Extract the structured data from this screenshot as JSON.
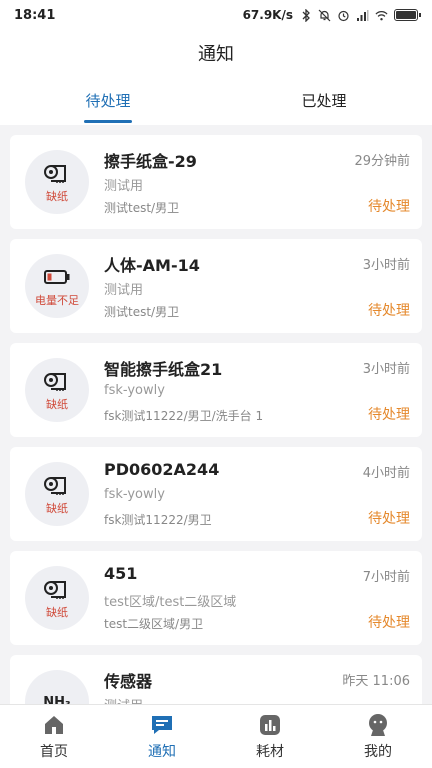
{
  "status_bar": {
    "time": "18:41",
    "net_speed": "67.9K/s"
  },
  "header": {
    "title": "通知"
  },
  "tabs": [
    {
      "label": "待处理",
      "active": true
    },
    {
      "label": "已处理",
      "active": false
    }
  ],
  "items": [
    {
      "badge_icon": "paper-roll-icon",
      "badge_label": "缺纸",
      "name": "擦手纸盒-29",
      "time": "29分钟前",
      "subtitle": "测试用",
      "location": "测试test/男卫",
      "status": "待处理"
    },
    {
      "badge_icon": "low-battery-icon",
      "badge_label": "电量不足",
      "name": "人体-AM-14",
      "time": "3小时前",
      "subtitle": "测试用",
      "location": "测试test/男卫",
      "status": "待处理"
    },
    {
      "badge_icon": "paper-roll-icon",
      "badge_label": "缺纸",
      "name": "智能擦手纸盒21",
      "time": "3小时前",
      "subtitle": "fsk-yowly",
      "location": "fsk测试11222/男卫/洗手台 1",
      "status": "待处理"
    },
    {
      "badge_icon": "paper-roll-icon",
      "badge_label": "缺纸",
      "name": "PD0602A244",
      "time": "4小时前",
      "subtitle": "fsk-yowly",
      "location": "fsk测试11222/男卫",
      "status": "待处理"
    },
    {
      "badge_icon": "paper-roll-icon",
      "badge_label": "缺纸",
      "name": "451",
      "time": "7小时前",
      "subtitle": "test区域/test二级区域",
      "location": "test二级区域/男卫",
      "status": "待处理"
    },
    {
      "badge_icon": "nh3-icon",
      "badge_text": "NH₃",
      "badge_label": "",
      "name": "传感器",
      "time": "昨天 11:06",
      "subtitle": "测试用",
      "location": "",
      "status": ""
    }
  ],
  "bottom_nav": [
    {
      "label": "首页",
      "icon": "home-icon",
      "active": false
    },
    {
      "label": "通知",
      "icon": "message-icon",
      "active": true
    },
    {
      "label": "耗材",
      "icon": "chart-icon",
      "active": false
    },
    {
      "label": "我的",
      "icon": "user-icon",
      "active": false
    }
  ],
  "colors": {
    "accent": "#1f6fb5",
    "pending": "#e5892d",
    "alert": "#d04a3a"
  }
}
